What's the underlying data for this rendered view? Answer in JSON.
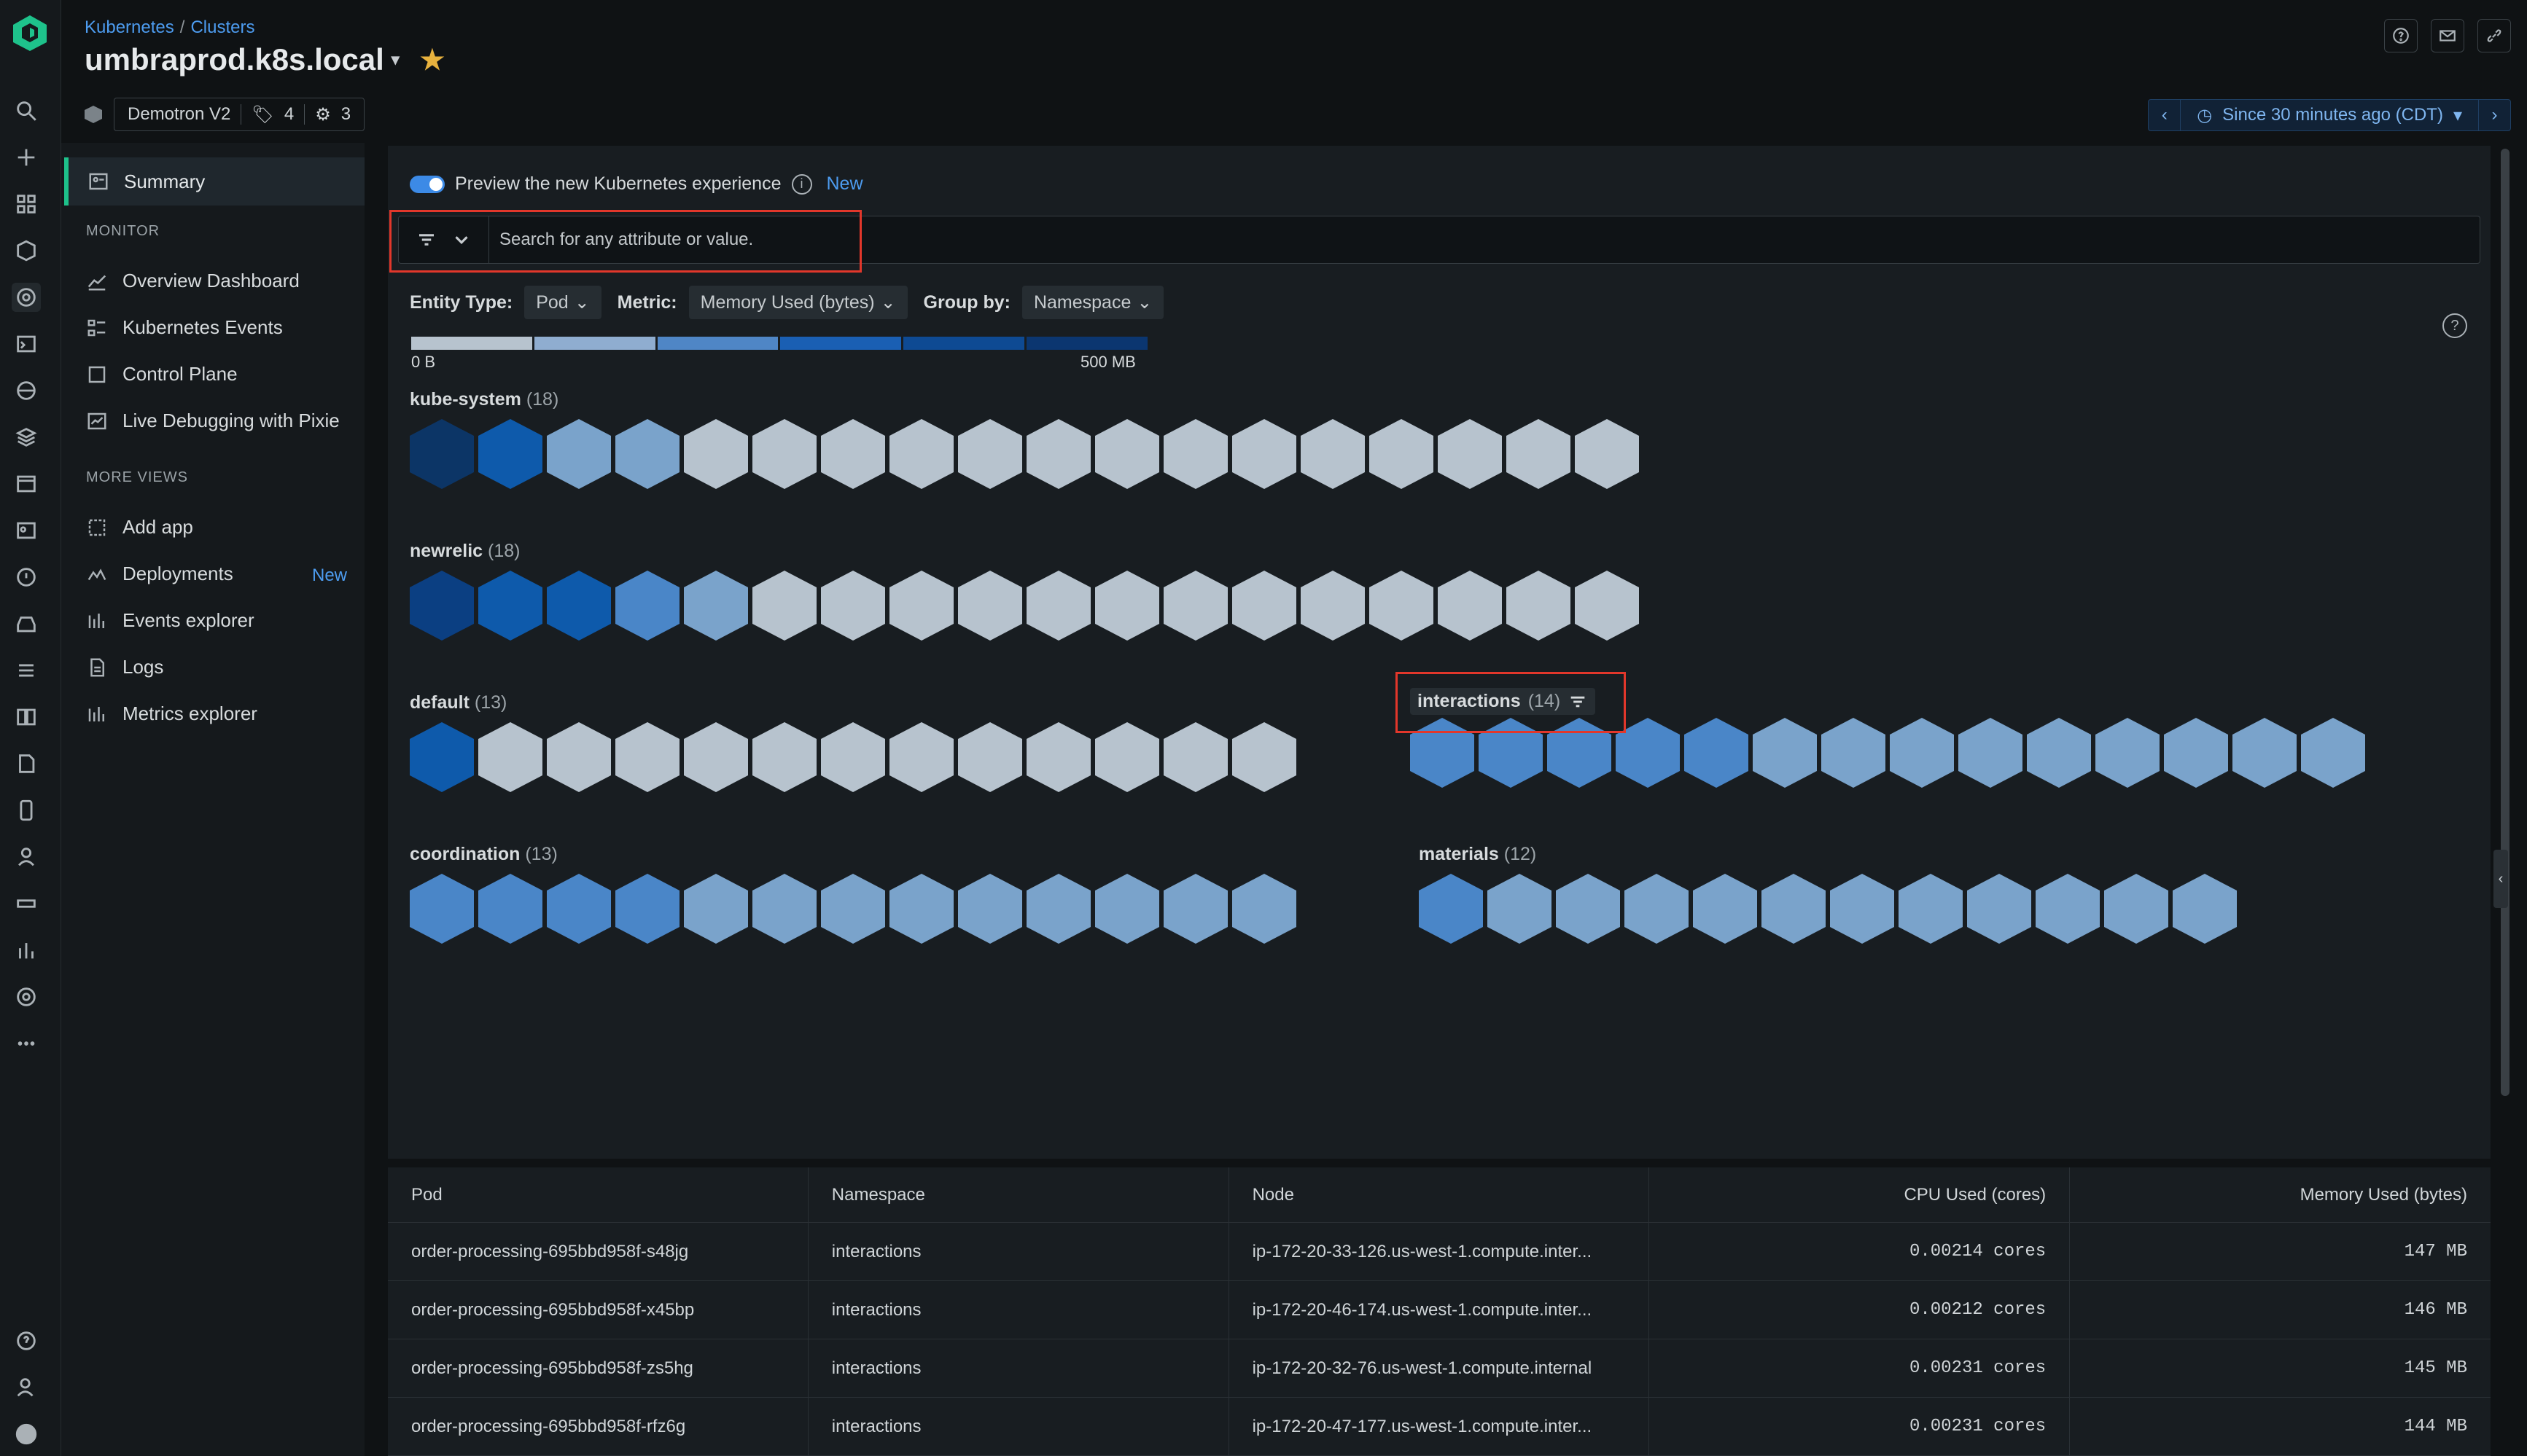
{
  "breadcrumb": {
    "parent": "Kubernetes",
    "sep": "/",
    "current": "Clusters"
  },
  "page_title": "umbraprod.k8s.local",
  "meta": {
    "account": "Demotron V2",
    "tags_count": "4",
    "related_count": "3"
  },
  "time_picker": {
    "label": "Since 30 minutes ago (CDT)"
  },
  "sidebar": {
    "summary": "Summary",
    "monitor_header": "MONITOR",
    "monitor_items": [
      "Overview Dashboard",
      "Kubernetes Events",
      "Control Plane",
      "Live Debugging with Pixie"
    ],
    "more_header": "MORE VIEWS",
    "more_items": [
      "Add app",
      "Deployments",
      "Events explorer",
      "Logs",
      "Metrics explorer"
    ],
    "deployments_badge": "New"
  },
  "preview": {
    "label": "Preview the new Kubernetes experience",
    "badge": "New"
  },
  "search": {
    "placeholder": "Search for any attribute or value."
  },
  "filters": {
    "entity_label": "Entity Type:",
    "entity_value": "Pod",
    "metric_label": "Metric:",
    "metric_value": "Memory Used (bytes)",
    "group_label": "Group by:",
    "group_value": "Namespace"
  },
  "legend": {
    "min": "0 B",
    "max": "500 MB",
    "colors": [
      "#b7c3ce",
      "#8fadd0",
      "#4f86c6",
      "#1a5fb3",
      "#0e4a93",
      "#0b3670"
    ]
  },
  "groups": [
    {
      "name": "kube-system",
      "count": "(18)",
      "colors": [
        "#0c3566",
        "#0e5aab",
        "#7aa3cb",
        "#7aa3cb",
        "#b7c3ce",
        "#b7c3ce",
        "#b7c3ce",
        "#b7c3ce",
        "#b7c3ce",
        "#b7c3ce",
        "#b7c3ce",
        "#b7c3ce",
        "#b7c3ce",
        "#b7c3ce",
        "#b7c3ce",
        "#b7c3ce",
        "#b7c3ce",
        "#b7c3ce"
      ]
    },
    {
      "name": "newrelic",
      "count": "(18)",
      "colors": [
        "#0b3f82",
        "#0e5aab",
        "#0e5aab",
        "#4a86c8",
        "#7aa3cb",
        "#b7c3ce",
        "#b7c3ce",
        "#b7c3ce",
        "#b7c3ce",
        "#b7c3ce",
        "#b7c3ce",
        "#b7c3ce",
        "#b7c3ce",
        "#b7c3ce",
        "#b7c3ce",
        "#b7c3ce",
        "#b7c3ce",
        "#b7c3ce"
      ]
    },
    {
      "name": "default",
      "count": "(13)",
      "colors": [
        "#0e5aab",
        "#b7c3ce",
        "#b7c3ce",
        "#b7c3ce",
        "#b7c3ce",
        "#b7c3ce",
        "#b7c3ce",
        "#b7c3ce",
        "#b7c3ce",
        "#b7c3ce",
        "#b7c3ce",
        "#b7c3ce",
        "#b7c3ce"
      ]
    },
    {
      "name": "interactions",
      "count": "(14)",
      "colors": [
        "#4a86c8",
        "#4a86c8",
        "#4a86c8",
        "#4a86c8",
        "#4a86c8",
        "#7aa3cb",
        "#7aa3cb",
        "#7aa3cb",
        "#7aa3cb",
        "#7aa3cb",
        "#7aa3cb",
        "#7aa3cb",
        "#7aa3cb",
        "#7aa3cb"
      ]
    },
    {
      "name": "coordination",
      "count": "(13)",
      "colors": [
        "#4a86c8",
        "#4a86c8",
        "#4a86c8",
        "#4a86c8",
        "#7aa3cb",
        "#7aa3cb",
        "#7aa3cb",
        "#7aa3cb",
        "#7aa3cb",
        "#7aa3cb",
        "#7aa3cb",
        "#7aa3cb",
        "#7aa3cb"
      ]
    },
    {
      "name": "materials",
      "count": "(12)",
      "colors": [
        "#4a86c8",
        "#7aa3cb",
        "#7aa3cb",
        "#7aa3cb",
        "#7aa3cb",
        "#7aa3cb",
        "#7aa3cb",
        "#7aa3cb",
        "#7aa3cb",
        "#7aa3cb",
        "#7aa3cb",
        "#7aa3cb"
      ]
    }
  ],
  "table": {
    "headers": [
      "Pod",
      "Namespace",
      "Node",
      "CPU Used (cores)",
      "Memory Used (bytes)"
    ],
    "rows": [
      [
        "order-processing-695bbd958f-s48jg",
        "interactions",
        "ip-172-20-33-126.us-west-1.compute.inter...",
        "0.00214 cores",
        "147 MB"
      ],
      [
        "order-processing-695bbd958f-x45bp",
        "interactions",
        "ip-172-20-46-174.us-west-1.compute.inter...",
        "0.00212 cores",
        "146 MB"
      ],
      [
        "order-processing-695bbd958f-zs5hg",
        "interactions",
        "ip-172-20-32-76.us-west-1.compute.internal",
        "0.00231 cores",
        "145 MB"
      ],
      [
        "order-processing-695bbd958f-rfz6g",
        "interactions",
        "ip-172-20-47-177.us-west-1.compute.inter...",
        "0.00231 cores",
        "144 MB"
      ]
    ]
  }
}
